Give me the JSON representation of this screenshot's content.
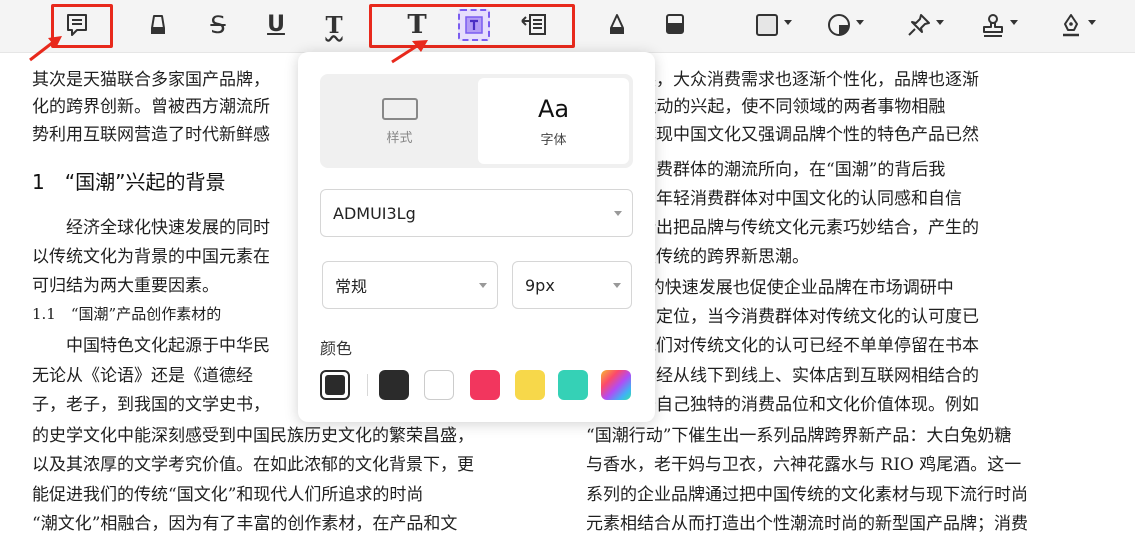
{
  "toolbar": {
    "tools": [
      "note-icon",
      "highlighter-icon",
      "strikethrough-icon",
      "underline-icon",
      "squiggly-icon",
      "text-icon",
      "textbox-icon",
      "callout-icon",
      "pencil-icon",
      "eraser-icon",
      "rectangle-icon",
      "shape-icon",
      "pin-icon",
      "stamp-icon",
      "signature-icon"
    ],
    "strike_glyph": "S",
    "underline_glyph": "U",
    "squiggly_glyph": "T",
    "text_glyph": "T",
    "highlight_color": "#e8291c",
    "active_color": "#7a5cf0"
  },
  "panel": {
    "tabs": [
      {
        "label": "样式",
        "active": false
      },
      {
        "label": "字体",
        "active": true,
        "glyph": "Aa"
      }
    ],
    "font_name": "ADMUI3Lg",
    "font_style": "常规",
    "font_size": "9px",
    "color_label": "颜色",
    "current_color": "#2b2b2b",
    "swatches": [
      "#2b2b2b",
      "#ffffff",
      "#f2365e",
      "#f7d84a",
      "#35d1b6",
      "gradient"
    ]
  },
  "document": {
    "left_lines": [
      "其次是天猫联合多家国产品牌，",
      "化的跨界创新。曾被西方潮流所",
      "势利用互联网营造了时代新鲜感"
    ],
    "heading": "1　“国潮”兴起的背景",
    "left_lines_2": [
      "　　经济全球化快速发展的同时",
      "以传统文化为背景的中国元素在",
      "可归结为两大重要因素。"
    ],
    "subheading": "1.1　“国潮”产品创作素材的",
    "left_lines_3": [
      "　　中国特色文化起源于中华民",
      "无论从《论语》还是《道德经",
      "子，老子，到我国的文学史书，",
      "的史学文化中能深刻感受到中国民族历史文化的繁荣昌盛，",
      "以及其浓厚的文学考究价值。在如此浓郁的文化背景下，更",
      "能促进我们的传统“国文化”和现代人们所追求的时尚",
      "“潮文化”相融合，因为有了丰富的创作素材，在产品和文"
    ],
    "right_lines": [
      "会的发展，大众消费需求也逐渐个性化，品牌也逐渐",
      "“国潮”运动的兴起，使不同领域的两者事物相融",
      "新出既体现中国文化又强调品牌个性的特色产品已然",
      "前年轻消费群体的潮流所向，在“国潮”的背后我",
      "分感受到年轻消费群体对中国文化的认同感和自信",
      "从而盛行出把品牌与传统文化元素巧妙结合，产生的",
      "尚与历史传统的跨界新思潮。",
      "潮行动”的快速发展也促使企业品牌在市场调研中",
      "者的准确定位，当今消费群体对传统文化的认可度已",
      "越高，他们对传统文化的认可已经不单单停留在书本",
      "，而是已经从线下到线上、实体店到互联网相结合的",
      "表现属于自己独特的消费品位和文化价值体现。例如",
      "“国潮行动”下催生出一系列品牌跨界新产品：大白兔奶糖",
      "与香水，老干妈与卫衣，六神花露水与 RIO 鸡尾酒。这一",
      "系列的企业品牌通过把中国传统的文化素材与现下流行时尚",
      "元素相结合从而打造出个性潮流时尚的新型国产品牌；消费"
    ]
  }
}
